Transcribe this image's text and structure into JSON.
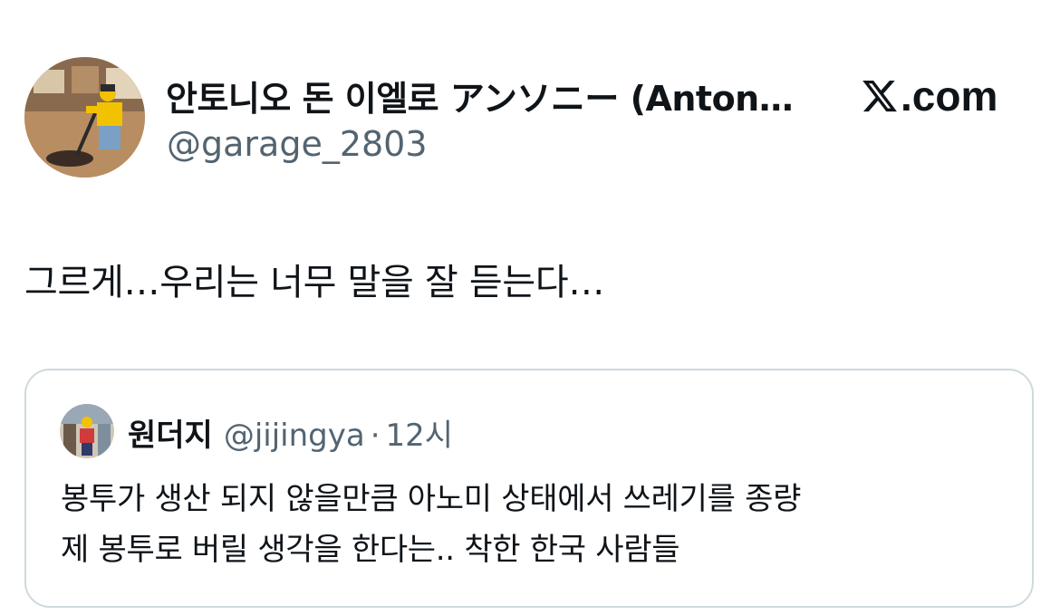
{
  "header": {
    "author_name": "안토니오 돈 이엘로 アンソニー (Anton…",
    "author_handle": "@garage_2803",
    "site_label": ".com",
    "avatar_icon": "lego-figure-avatar-icon"
  },
  "tweet": {
    "text": "그르게…우리는 너무 말을 잘 듣는다…"
  },
  "quote": {
    "name": "원더지",
    "handle": "@jijingya",
    "separator": "·",
    "time": "12시",
    "text_lines": [
      "봉투가 생산 되지 않을만큼 아노미 상태에서 쓰레기를 종량",
      "제 봉투로 버릴 생각을 한다는.. 착한 한국 사람들"
    ],
    "avatar_icon": "figure-avatar-icon"
  },
  "colors": {
    "text_primary": "#0f1419",
    "text_secondary": "#536471",
    "border": "#cfd9de"
  }
}
